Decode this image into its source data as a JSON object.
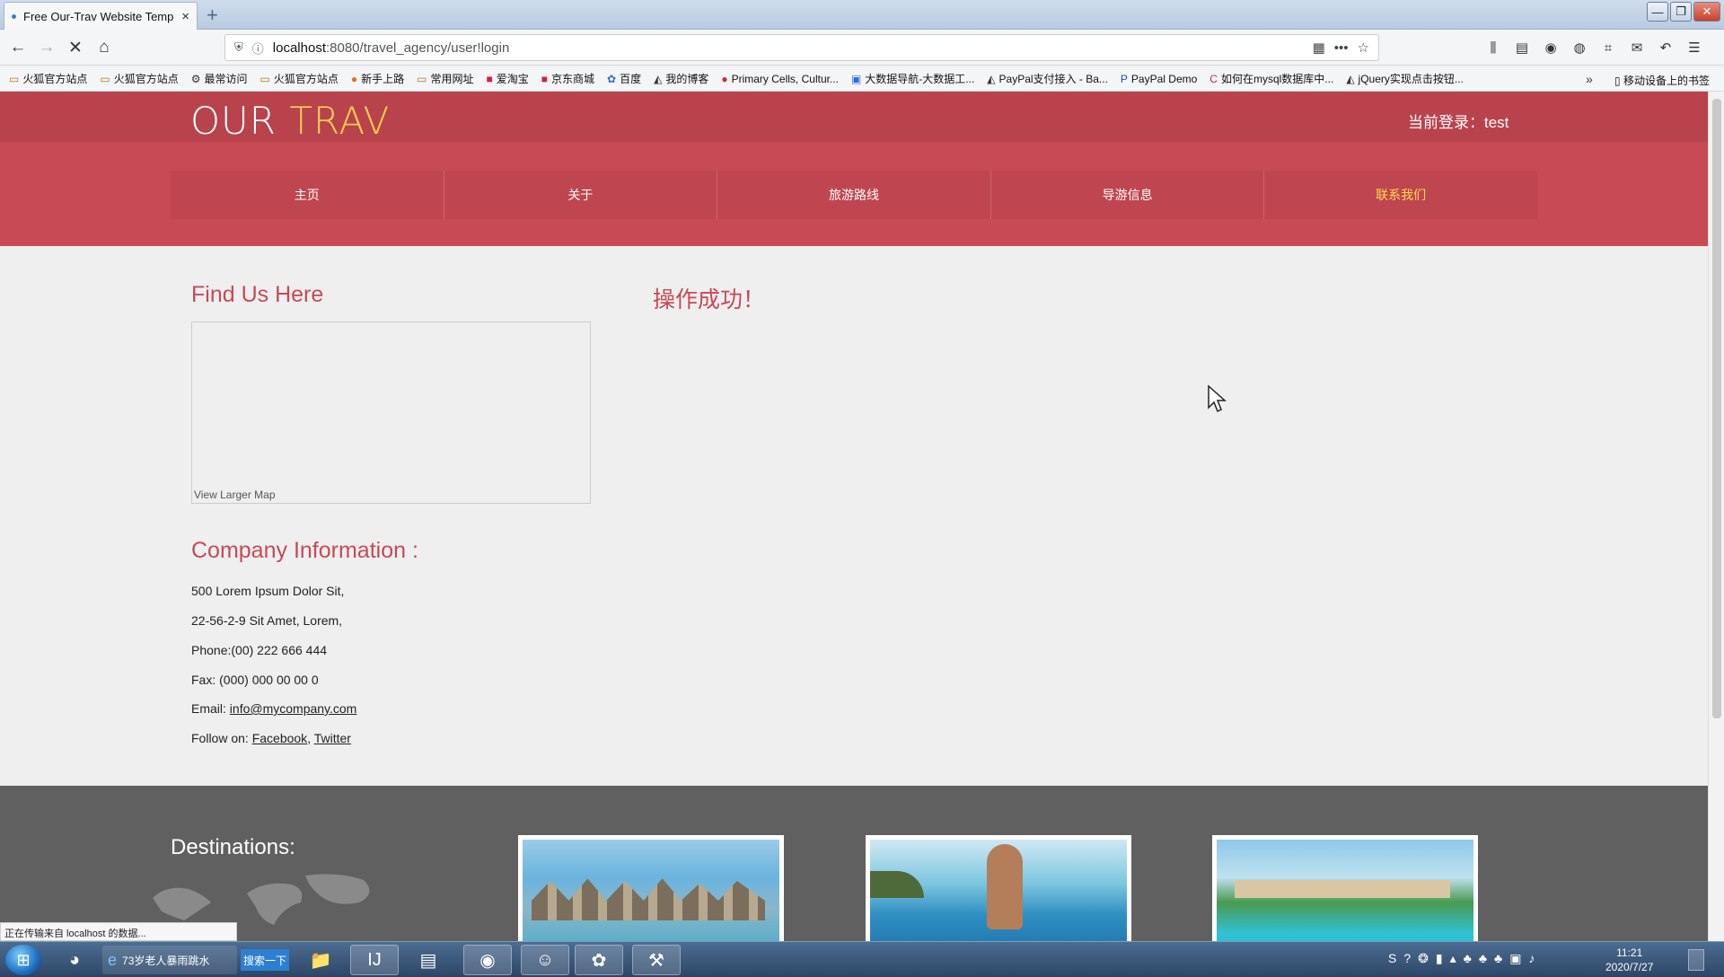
{
  "browser": {
    "tab_title": "Free Our-Trav Website Temp",
    "tab_close": "×",
    "new_tab": "+",
    "url_host": "localhost",
    "url_path": ":8080/travel_agency/user!login",
    "icons": {
      "back": "back-arrow-icon",
      "forward": "forward-arrow-icon",
      "stop": "stop-icon",
      "home": "home-icon",
      "shield": "shield-icon",
      "info": "info-icon",
      "qr": "qr-code-icon",
      "more": "more-icon",
      "star": "bookmark-star-icon"
    },
    "bookmarks": [
      "火狐官方站点",
      "火狐官方站点",
      "最常访问",
      "火狐官方站点",
      "新手上路",
      "常用网址",
      "爱淘宝",
      "京东商城",
      "百度",
      "我的博客",
      "Primary Cells, Cultur...",
      "大数据导航-大数据工...",
      "PayPal支付接入 - Ba...",
      "PayPal Demo",
      "如何在mysql数据库中...",
      "jQuery实现点击按钮..."
    ],
    "bookmarks_more": "»",
    "mobile_bookmarks": "移动设备上的书签",
    "status_text": "正在传输来自 localhost 的数据..."
  },
  "site": {
    "logo_part1": "OUR ",
    "logo_part2": "TRAV",
    "login_status": "当前登录：test",
    "menu": [
      {
        "label": "主页",
        "active": false
      },
      {
        "label": "关于",
        "active": false
      },
      {
        "label": "旅游路线",
        "active": false
      },
      {
        "label": "导游信息",
        "active": false
      },
      {
        "label": "联系我们",
        "active": true
      }
    ],
    "find_us_title": "Find Us Here",
    "map_link": "View Larger Map",
    "success_message": "操作成功！",
    "company_title": "Company Information :",
    "company_lines": {
      "address1": "500 Lorem Ipsum Dolor Sit,",
      "address2": "22-56-2-9 Sit Amet, Lorem,",
      "phone": "Phone:(00) 222 666 444",
      "fax": "Fax: (000) 000 00 00 0",
      "email_label": "Email: ",
      "email": "info@mycompany.com",
      "follow_label": "Follow on: ",
      "facebook": "Facebook",
      "comma": ", ",
      "twitter": "Twitter"
    },
    "destinations_title": "Destinations:"
  },
  "taskbar": {
    "ie_label": "73岁老人暴雨跳水",
    "search_button": "搜索一下",
    "clock_time": "11:21",
    "clock_date": "2020/7/27"
  },
  "colors": {
    "header": "#c84a54",
    "accent_text": "#c44b55",
    "active_menu": "#ffd84a",
    "footer": "#606060"
  }
}
